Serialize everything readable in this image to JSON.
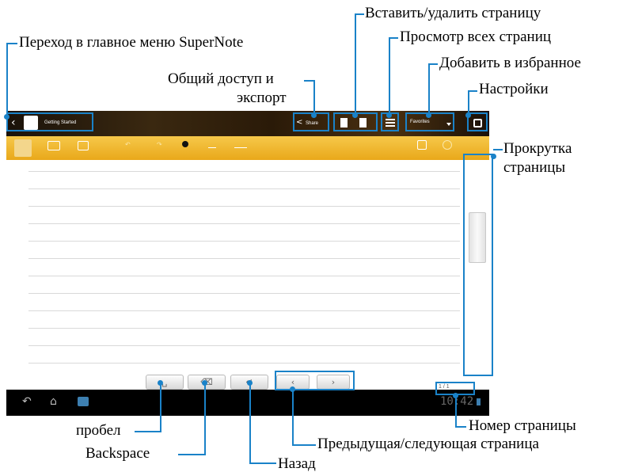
{
  "callouts": {
    "insert_delete_page": "Вставить/удалить страницу",
    "main_menu": "Переход в главное меню SuperNote",
    "view_all_pages": "Просмотр всех страниц",
    "share_export_line1": "Общий доступ и",
    "share_export_line2": "экспорт",
    "add_favorite": "Добавить в избранное",
    "settings": "Настройки",
    "scroll_line1": "Прокрутка",
    "scroll_line2": "страницы",
    "page_number": "Номер страницы",
    "space": "пробел",
    "backspace": "Backspace",
    "prev_next": "Предыдущая/следующая страница",
    "back": "Назад"
  },
  "app": {
    "notebook_title": "Getting Started",
    "share_label": "Share",
    "favorites_label": "Favorites",
    "page_indicator": "1 / 1",
    "clock": "10:42"
  },
  "toolbar": {
    "items": [
      "Scribble",
      "Keyboard",
      "Insert",
      "",
      "",
      "Color",
      "Stroke",
      "Read Only",
      "Disable Edit"
    ]
  },
  "keys": {
    "space": "␣",
    "backspace": "⌫",
    "enter": "↵",
    "prev": "‹",
    "next": "›"
  },
  "colors": {
    "callout_blue": "#1a82c8",
    "toolbar_yellow": "#f0b530",
    "system_bar": "#000000"
  }
}
